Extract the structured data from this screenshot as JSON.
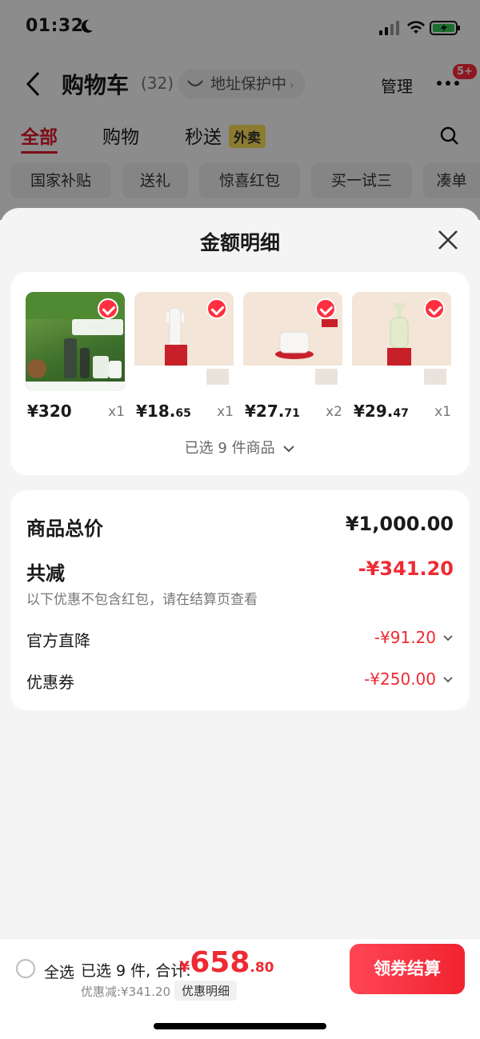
{
  "status_bar": {
    "time": "01:32"
  },
  "nav": {
    "title": "购物车",
    "count": "(32)",
    "address_chip": "地址保护中",
    "manage": "管理",
    "badge": "5+"
  },
  "tabs": [
    {
      "label": "全部"
    },
    {
      "label": "购物"
    },
    {
      "label": "秒送"
    }
  ],
  "tab_tag": "外卖",
  "chips": [
    "国家补贴",
    "送礼",
    "惊喜红包",
    "买一试三",
    "凑单"
  ],
  "sheet": {
    "title": "金额明细",
    "products": [
      {
        "price_int": "¥320",
        "price_dec": "",
        "qty": "x1"
      },
      {
        "price_int": "¥18.",
        "price_dec": "65",
        "qty": "x1"
      },
      {
        "price_int": "¥27.",
        "price_dec": "71",
        "qty": "x2"
      },
      {
        "price_int": "¥29.",
        "price_dec": "47",
        "qty": "x1"
      }
    ],
    "selected_count": "已选 9 件商品",
    "summary": {
      "total_label": "商品总价",
      "total_value": "¥1,000.00",
      "reduce_label": "共减",
      "reduce_value": "-¥341.20",
      "note": "以下优惠不包含红包，请在结算页查看",
      "official_label": "官方直降",
      "official_value": "-¥91.20",
      "coupon_label": "优惠券",
      "coupon_value": "-¥250.00"
    }
  },
  "bottom_bar": {
    "select_all": "全选",
    "selected_text": "已选 9 件, 合计:",
    "price_currency": "¥",
    "price_int": "658",
    "price_dec": ".80",
    "discount_text": "优惠减:¥341.20",
    "detail_chip": "优惠明细",
    "checkout": "领券结算"
  },
  "colors": {
    "accent": "#ee2a33",
    "brand_red": "#e3182d",
    "tag_yellow": "#ffe25a"
  }
}
